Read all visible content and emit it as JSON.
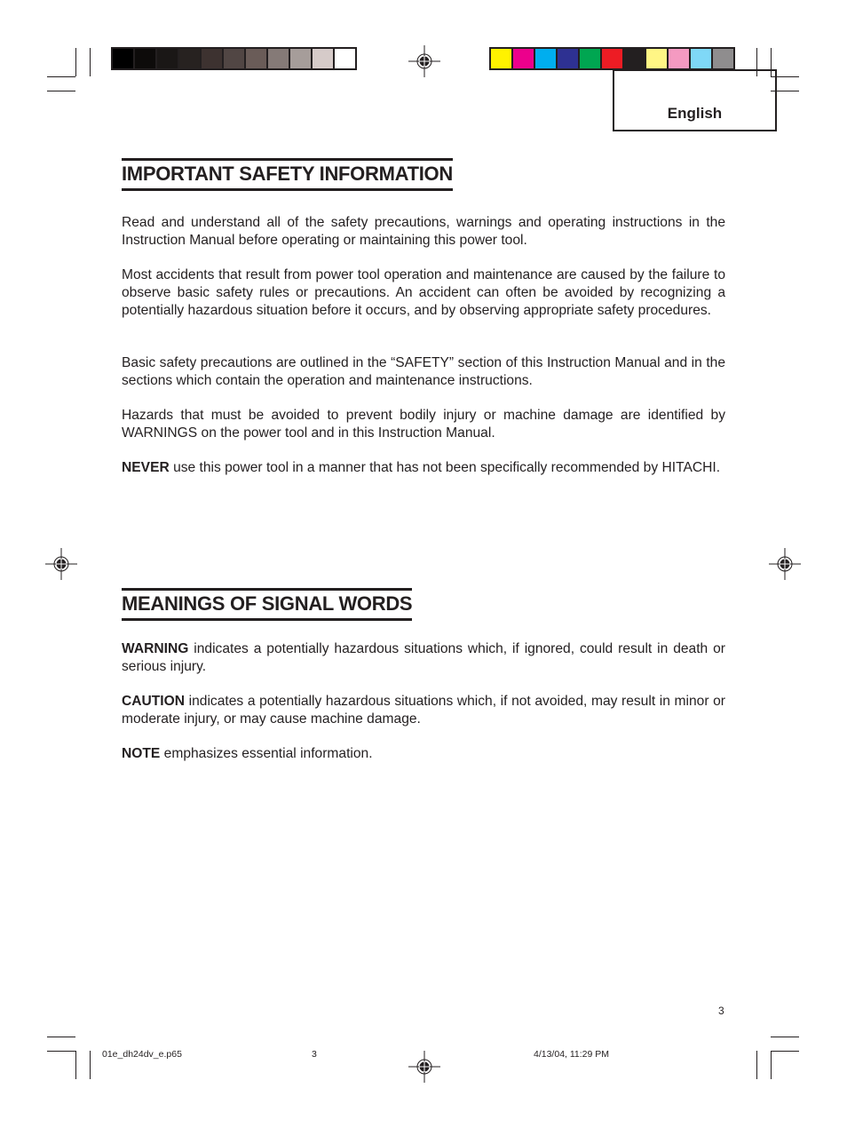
{
  "header": {
    "language_label": "English",
    "grayscale_swatches": [
      "#000000",
      "#0d0b0a",
      "#1a1716",
      "#272220",
      "#3d3230",
      "#514644",
      "#6a5c58",
      "#857a77",
      "#a69d9a",
      "#d6cbc9",
      "#ffffff"
    ],
    "color_swatches": [
      "#fff200",
      "#ec008c",
      "#00aeef",
      "#2e3192",
      "#00a651",
      "#ed1c24",
      "#231f20",
      "#fff685",
      "#f49ac1",
      "#7fd8f7",
      "#8f8d8e"
    ]
  },
  "sections": [
    {
      "title": "IMPORTANT SAFETY INFORMATION",
      "paragraphs": [
        {
          "lead": "",
          "text": "Read and understand all of the safety precautions, warnings and operating instructions in the Instruction Manual before operating or maintaining this power tool."
        },
        {
          "lead": "",
          "text": "Most accidents that result from power tool operation and maintenance are caused by the failure to observe basic safety rules or precautions. An accident can often be avoided by recognizing a potentially hazardous situation before it occurs, and by observing appropriate safety procedures."
        },
        {
          "lead": "",
          "text": "Basic safety precautions are outlined in the “SAFETY” section of this Instruction Manual and in the sections which contain the operation and maintenance instructions."
        },
        {
          "lead": "",
          "text": "Hazards that must be avoided to prevent bodily injury or machine damage are identified by WARNINGS on the power tool and in this Instruction Manual."
        },
        {
          "lead": "NEVER",
          "text": " use this power tool in a manner that has not been specifically recommended by HITACHI."
        }
      ]
    },
    {
      "title": "MEANINGS OF SIGNAL WORDS",
      "paragraphs": [
        {
          "lead": "WARNING",
          "text": " indicates a potentially hazardous situations which, if ignored, could result in death or serious injury."
        },
        {
          "lead": "CAUTION",
          "text": " indicates a potentially hazardous situations which, if not avoided, may result in minor or moderate injury, or may cause machine damage."
        },
        {
          "lead": "NOTE",
          "text": " emphasizes essential information."
        }
      ]
    }
  ],
  "footer": {
    "page_number": "3",
    "slug_filename": "01e_dh24dv_e.p65",
    "slug_page": "3",
    "slug_timestamp": "4/13/04, 11:29 PM"
  }
}
